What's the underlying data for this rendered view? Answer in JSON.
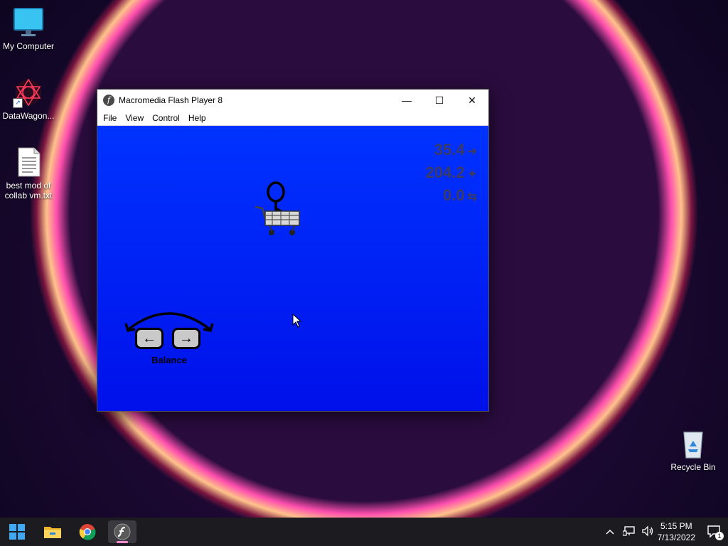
{
  "desktop": {
    "icons": [
      {
        "label": "My Computer",
        "icon": "monitor-icon"
      },
      {
        "label": "DataWagon...",
        "icon": "datawagon-icon"
      },
      {
        "label": "best mod of collab vm.txt",
        "icon": "text-file-icon"
      },
      {
        "label": "Recycle Bin",
        "icon": "recycle-bin-icon"
      }
    ]
  },
  "window": {
    "title": "Macromedia Flash Player 8",
    "app_icon_glyph": "f",
    "controls": {
      "minimize": "—",
      "maximize": "☐",
      "close": "✕"
    },
    "menu": [
      "File",
      "View",
      "Control",
      "Help"
    ]
  },
  "game": {
    "readouts": [
      {
        "value": "35.4",
        "arrow": "➜"
      },
      {
        "value": "204.2",
        "arrow": "✦"
      },
      {
        "value": "0.0",
        "arrow": "⇆"
      }
    ],
    "balance": {
      "left_key": "←",
      "right_key": "→",
      "label": "Balance"
    },
    "stage_color_top": "#0033ff",
    "stage_color_bottom": "#0010ea"
  },
  "taskbar": {
    "apps": [
      "start-icon",
      "file-explorer-icon",
      "chrome-icon",
      "flash-player-icon"
    ],
    "active_app": "flash-player-icon",
    "clock_time": "5:15 PM",
    "clock_date": "7/13/2022",
    "notification_count": "1",
    "accent": "#ff8bd0"
  }
}
